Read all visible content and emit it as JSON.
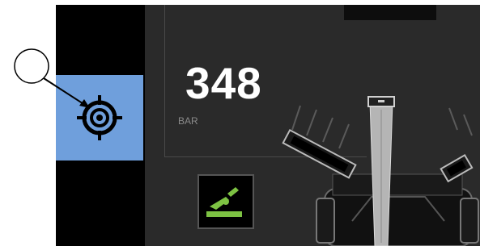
{
  "pressure": {
    "value": "348",
    "unit": "BAR"
  },
  "buttons": {
    "target": {
      "icon": "crosshair-target-icon",
      "state": "active",
      "color": "#6f9fdc"
    },
    "pedal": {
      "icon": "foot-pedal-icon",
      "color": "#7dc243"
    }
  },
  "machine_view": {
    "icon": "excavator-top-view-icon"
  },
  "callout": {
    "icon": "callout-circle-icon"
  }
}
